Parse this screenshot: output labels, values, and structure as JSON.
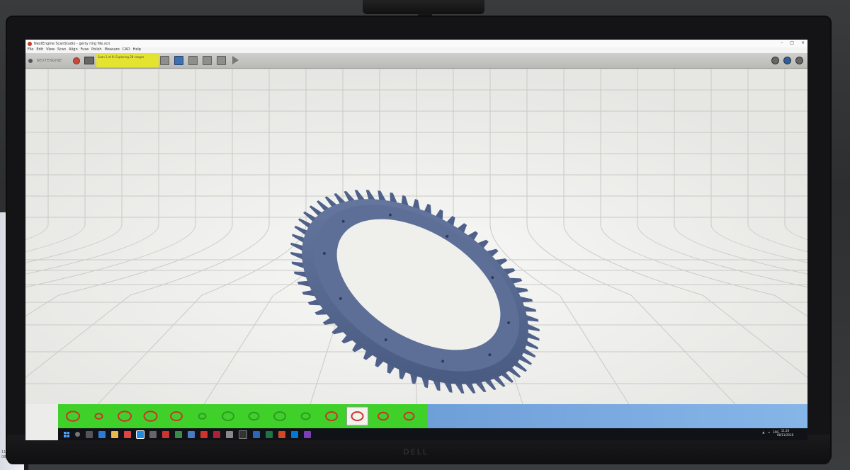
{
  "window": {
    "title": "NextEngine ScanStudio - gerry ring file.scn",
    "controls": [
      "–",
      "□",
      "×"
    ]
  },
  "menu": {
    "items": [
      "File",
      "Edit",
      "View",
      "Scan",
      "Align",
      "Fuse",
      "Polish",
      "Measure",
      "CAD",
      "Help"
    ]
  },
  "toolbar": {
    "brand": "NEXTENGINE",
    "status": "Scan 1 of 8: Exploring 28 ranges",
    "icons": [
      "camera-icon",
      "scan-icon",
      "align-icon",
      "trim-icon",
      "fuse-icon",
      "play-icon"
    ],
    "right_icons": [
      "settings-icon",
      "help-icon",
      "close-circle-icon"
    ]
  },
  "scans": {
    "count": 14,
    "selected_index": 11
  },
  "taskbar": {
    "tray_lang": "ENG",
    "time": "11:20",
    "date": "08/11/2018"
  },
  "side_monitor": {
    "time": "11:20",
    "date": "08/11/2018"
  },
  "monitor": {
    "brand": "DELL"
  },
  "colors": {
    "model": "#56688f",
    "status_bar": "#e4e330",
    "scan_strip": "#3fd12a",
    "scan_strip_right": "#7aabe0"
  }
}
